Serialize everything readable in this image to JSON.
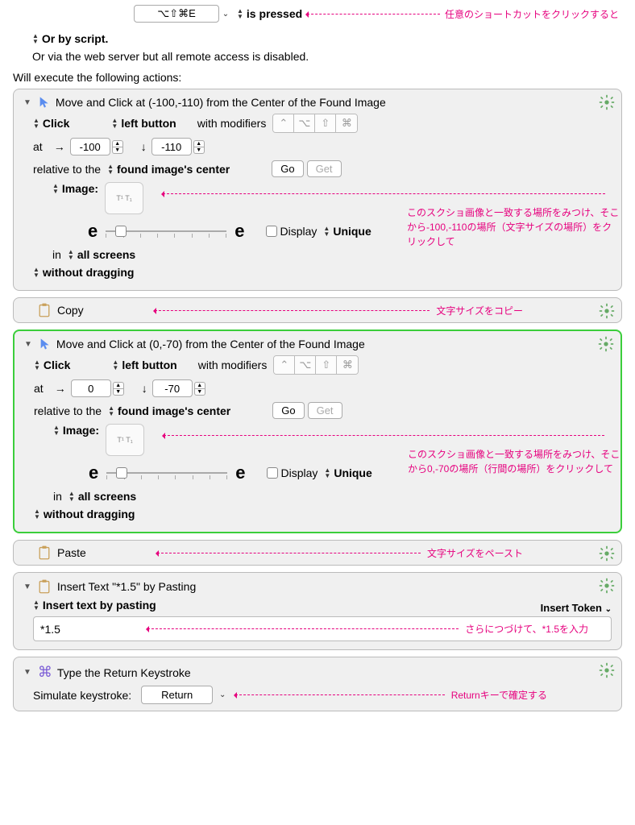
{
  "shortcut": {
    "keys": "⌥⇧⌘E",
    "pressed_label": "is pressed"
  },
  "annotations": {
    "shortcut": "任意のショートカットをクリックすると",
    "img1": "このスクショ画像と一致する場所をみつけ、そこから-100,-110の場所（文字サイズの場所）をクリックして",
    "copy": "文字サイズをコピー",
    "img2": "このスクショ画像と一致する場所をみつけ、そこから0,-70の場所（行間の場所）をクリックして",
    "paste": "文字サイズをペースト",
    "insert": "さらにつづけて、*1.5を入力",
    "return": "Returnキーで確定する"
  },
  "lines": {
    "script": "Or by script.",
    "remote": "Or via the web server but all remote access is disabled.",
    "exec": "Will execute the following actions:"
  },
  "action1": {
    "title": "Move and Click at (-100,-110) from the Center of the Found Image",
    "click": "Click",
    "button": "left button",
    "modifiers": "with modifiers",
    "at": "at",
    "x": "-100",
    "y": "-110",
    "relative": "relative to the",
    "target": "found image's center",
    "go": "Go",
    "get": "Get",
    "image": "Image:",
    "display": "Display",
    "unique": "Unique",
    "in": "in",
    "screens": "all screens",
    "drag": "without dragging"
  },
  "copy": {
    "label": "Copy"
  },
  "action2": {
    "title": "Move and Click at (0,-70) from the Center of the Found Image",
    "click": "Click",
    "button": "left button",
    "modifiers": "with modifiers",
    "at": "at",
    "x": "0",
    "y": "-70",
    "relative": "relative to the",
    "target": "found image's center",
    "go": "Go",
    "get": "Get",
    "image": "Image:",
    "display": "Display",
    "unique": "Unique",
    "in": "in",
    "screens": "all screens",
    "drag": "without dragging"
  },
  "paste": {
    "label": "Paste"
  },
  "insert": {
    "title": "Insert Text \"*1.5\" by Pasting",
    "method": "Insert text by pasting",
    "token": "Insert Token",
    "value": "*1.5"
  },
  "return_action": {
    "title": "Type the Return Keystroke",
    "simulate": "Simulate keystroke:",
    "key": "Return"
  }
}
